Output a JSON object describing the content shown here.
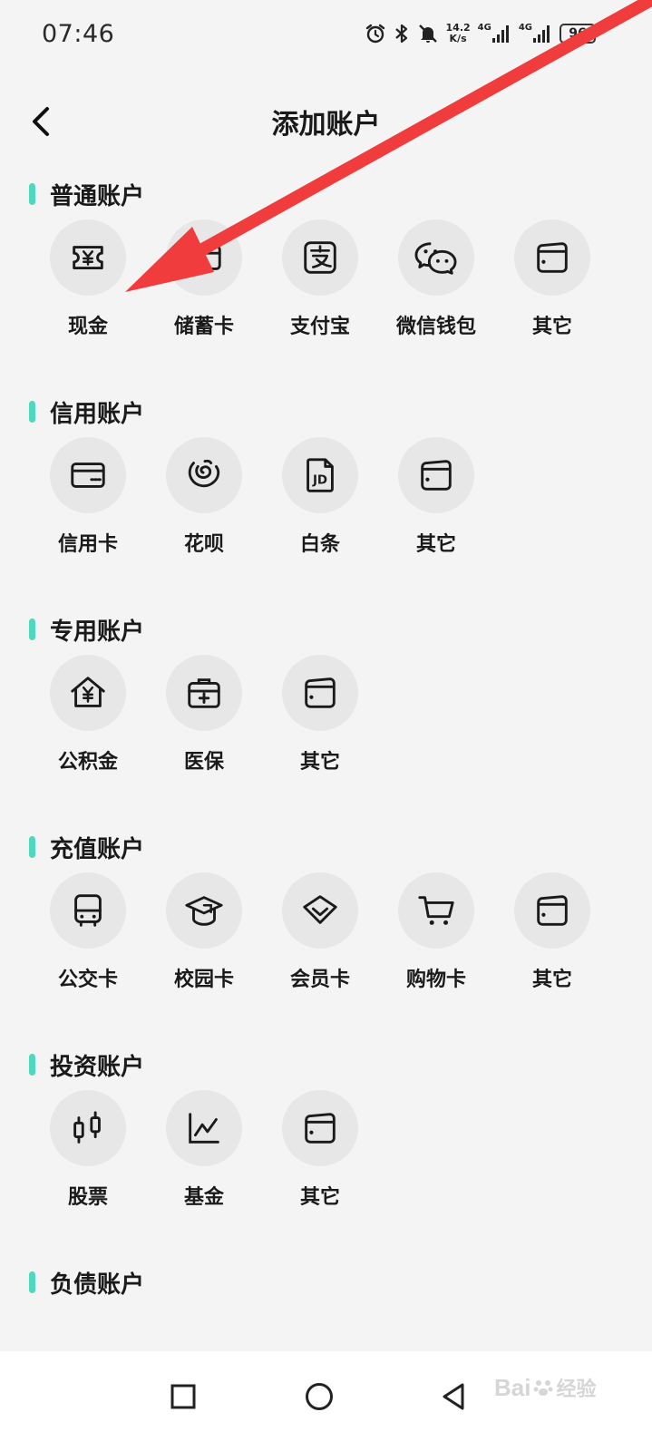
{
  "status_bar": {
    "time": "07:46",
    "net_speed_value": "14.2",
    "net_speed_unit": "K/s",
    "signal_1": "4G",
    "signal_2": "4G",
    "battery": "96",
    "icons": [
      "alarm-icon",
      "bluetooth-icon",
      "mute-icon",
      "signal-icon",
      "battery-icon"
    ]
  },
  "header": {
    "title": "添加账户",
    "back_icon": "chevron-left-icon"
  },
  "sections": [
    {
      "title": "普通账户",
      "items": [
        {
          "label": "现金",
          "icon": "cash-ticket-icon"
        },
        {
          "label": "储蓄卡",
          "icon": "debit-card-icon"
        },
        {
          "label": "支付宝",
          "icon": "alipay-icon"
        },
        {
          "label": "微信钱包",
          "icon": "wechat-icon"
        },
        {
          "label": "其它",
          "icon": "wallet-icon"
        }
      ]
    },
    {
      "title": "信用账户",
      "items": [
        {
          "label": "信用卡",
          "icon": "credit-card-icon"
        },
        {
          "label": "花呗",
          "icon": "huabei-icon"
        },
        {
          "label": "白条",
          "icon": "jd-baitiao-icon"
        },
        {
          "label": "其它",
          "icon": "wallet-icon"
        }
      ]
    },
    {
      "title": "专用账户",
      "items": [
        {
          "label": "公积金",
          "icon": "housing-fund-icon"
        },
        {
          "label": "医保",
          "icon": "medical-kit-icon"
        },
        {
          "label": "其它",
          "icon": "wallet-icon"
        }
      ]
    },
    {
      "title": "充值账户",
      "items": [
        {
          "label": "公交卡",
          "icon": "bus-icon"
        },
        {
          "label": "校园卡",
          "icon": "graduation-cap-icon"
        },
        {
          "label": "会员卡",
          "icon": "diamond-icon"
        },
        {
          "label": "购物卡",
          "icon": "shopping-cart-icon"
        },
        {
          "label": "其它",
          "icon": "wallet-icon"
        }
      ]
    },
    {
      "title": "投资账户",
      "items": [
        {
          "label": "股票",
          "icon": "candlestick-icon"
        },
        {
          "label": "基金",
          "icon": "line-chart-icon"
        },
        {
          "label": "其它",
          "icon": "wallet-icon"
        }
      ]
    },
    {
      "title": "负债账户",
      "items": []
    }
  ],
  "nav_bar": {
    "icons": [
      "recent-apps-icon",
      "home-icon",
      "back-triangle-icon"
    ]
  },
  "watermark": {
    "text": "Bai",
    "text2": "经验"
  },
  "colors": {
    "accent": "#4fd8bd",
    "arrow": "#f03c3c",
    "icon_circle": "#e7e7e7",
    "background": "#f4f4f4"
  }
}
